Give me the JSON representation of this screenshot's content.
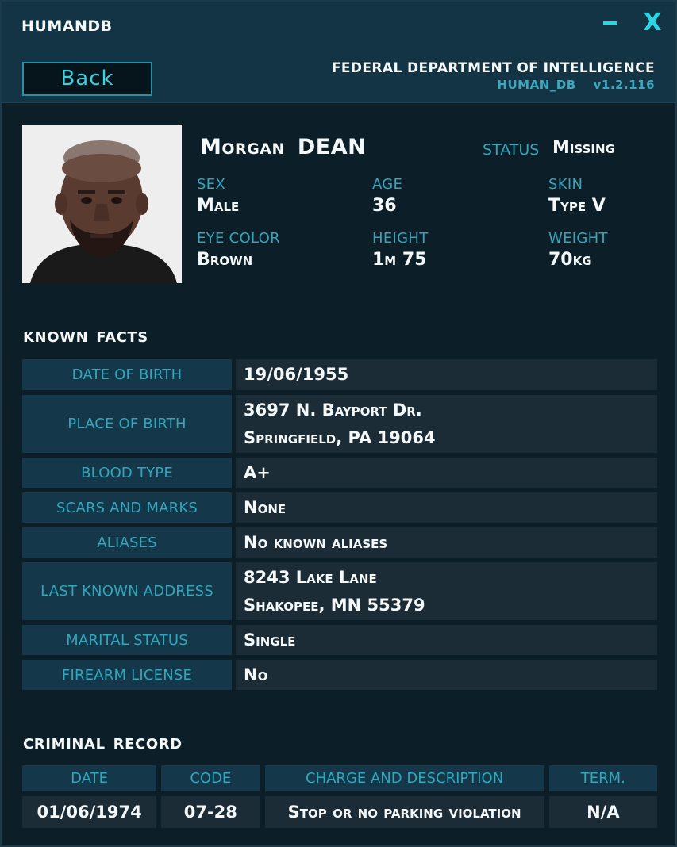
{
  "app": {
    "title": "HUMANDB",
    "minimize_icon": "minimize-icon",
    "close_label": "X"
  },
  "header": {
    "back_label": "Back",
    "department": "FEDERAL DEPARTMENT OF INTELLIGENCE",
    "db_name": "HUMAN_DB",
    "version": "v1.2.116"
  },
  "profile": {
    "first_name": "Morgan",
    "last_name": "DEAN",
    "status_label": "STATUS",
    "status_value": "Missing",
    "sex_label": "SEX",
    "sex_value": "Male",
    "age_label": "AGE",
    "age_value": "36",
    "skin_label": "SKIN",
    "skin_value": "Type V",
    "eye_label": "EYE COLOR",
    "eye_value": "Brown",
    "height_label": "HEIGHT",
    "height_value": "1m 75",
    "weight_label": "WEIGHT",
    "weight_value": "70kg"
  },
  "facts": {
    "title_1": "KNOWN",
    "title_2": "FACTS",
    "rows": [
      {
        "label": "DATE OF BIRTH",
        "lines": [
          "19/06/1955"
        ]
      },
      {
        "label": "PLACE OF BIRTH",
        "lines": [
          "3697 N. Bayport Dr.",
          "Springfield, PA 19064"
        ]
      },
      {
        "label": "BLOOD TYPE",
        "lines": [
          "A+"
        ]
      },
      {
        "label": "SCARS AND MARKS",
        "lines": [
          "None"
        ]
      },
      {
        "label": "ALIASES",
        "lines": [
          "No known aliases"
        ]
      },
      {
        "label": "LAST KNOWN ADDRESS",
        "lines": [
          "8243 Lake Lane",
          "Shakopee, MN 55379"
        ]
      },
      {
        "label": "MARITAL STATUS",
        "lines": [
          "Single"
        ]
      },
      {
        "label": "FIREARM LICENSE",
        "lines": [
          "No"
        ]
      }
    ]
  },
  "criminal": {
    "title_1": "CRIMINAL",
    "title_2": "RECORD",
    "headers": [
      "DATE",
      "CODE",
      "CHARGE AND DESCRIPTION",
      "TERM."
    ],
    "rows": [
      [
        "01/06/1974",
        "07-28",
        "Stop or no parking violation",
        "N/A"
      ]
    ]
  },
  "colors": {
    "accent": "#28d6e6",
    "label": "#2fa7bd",
    "label_bg": "#14384a",
    "value_bg": "#1b2c36",
    "window_bg": "#0c1e28"
  }
}
